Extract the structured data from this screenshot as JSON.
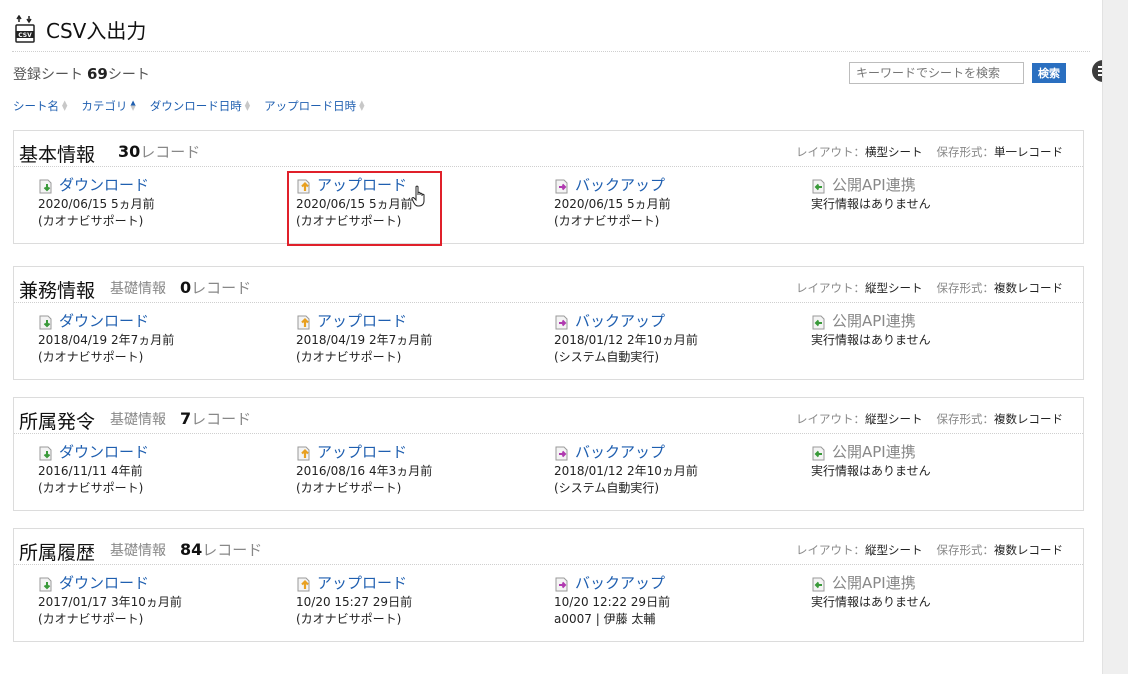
{
  "header": {
    "title": "CSV入出力",
    "icon": "csv-file-icon"
  },
  "summary": {
    "label": "登録シート",
    "count": "69",
    "unit": "シート"
  },
  "search": {
    "placeholder": "キーワードでシートを検索",
    "button": "検索"
  },
  "sort": [
    {
      "label": "シート名",
      "active": false
    },
    {
      "label": "カテゴリ",
      "active": true
    },
    {
      "label": "ダウンロード日時",
      "active": false
    },
    {
      "label": "アップロード日時",
      "active": false
    }
  ],
  "sheets": [
    {
      "name": "基本情報",
      "category": "",
      "count": "30",
      "unit": "レコード",
      "layout_label": "レイアウト：",
      "layout": "横型シート",
      "format_label": "保存形式：",
      "format": "単一レコード",
      "download": {
        "label": "ダウンロード",
        "line1": "2020/06/15 5ヵ月前",
        "line2": "(カオナビサポート)"
      },
      "upload": {
        "label": "アップロード",
        "line1": "2020/06/15 5ヵ月前",
        "line2": "(カオナビサポート)"
      },
      "backup": {
        "label": "バックアップ",
        "line1": "2020/06/15 5ヵ月前",
        "line2": "(カオナビサポート)"
      },
      "api": {
        "label": "公開API連携",
        "line1": "実行情報はありません"
      }
    },
    {
      "name": "兼務情報",
      "category": "基礎情報",
      "count": "0",
      "unit": "レコード",
      "layout_label": "レイアウト：",
      "layout": "縦型シート",
      "format_label": "保存形式：",
      "format": "複数レコード",
      "download": {
        "label": "ダウンロード",
        "line1": "2018/04/19 2年7ヵ月前",
        "line2": "(カオナビサポート)"
      },
      "upload": {
        "label": "アップロード",
        "line1": "2018/04/19 2年7ヵ月前",
        "line2": "(カオナビサポート)"
      },
      "backup": {
        "label": "バックアップ",
        "line1": "2018/01/12 2年10ヵ月前",
        "line2": "(システム自動実行)"
      },
      "api": {
        "label": "公開API連携",
        "line1": "実行情報はありません"
      }
    },
    {
      "name": "所属発令",
      "category": "基礎情報",
      "count": "7",
      "unit": "レコード",
      "layout_label": "レイアウト：",
      "layout": "縦型シート",
      "format_label": "保存形式：",
      "format": "複数レコード",
      "download": {
        "label": "ダウンロード",
        "line1": "2016/11/11 4年前",
        "line2": "(カオナビサポート)"
      },
      "upload": {
        "label": "アップロード",
        "line1": "2016/08/16 4年3ヵ月前",
        "line2": "(カオナビサポート)"
      },
      "backup": {
        "label": "バックアップ",
        "line1": "2018/01/12 2年10ヵ月前",
        "line2": "(システム自動実行)"
      },
      "api": {
        "label": "公開API連携",
        "line1": "実行情報はありません"
      }
    },
    {
      "name": "所属履歴",
      "category": "基礎情報",
      "count": "84",
      "unit": "レコード",
      "layout_label": "レイアウト：",
      "layout": "縦型シート",
      "format_label": "保存形式：",
      "format": "複数レコード",
      "download": {
        "label": "ダウンロード",
        "line1": "2017/01/17 3年10ヵ月前",
        "line2": "(カオナビサポート)"
      },
      "upload": {
        "label": "アップロード",
        "line1": "10/20 15:27 29日前",
        "line2": "(カオナビサポート)"
      },
      "backup": {
        "label": "バックアップ",
        "line1": "10/20 12:22 29日前",
        "line2": "a0007 | 伊藤 太輔"
      },
      "api": {
        "label": "公開API連携",
        "line1": "実行情報はありません"
      }
    }
  ],
  "colors": {
    "link": "#1f5fb0",
    "highlight": "#e0202a",
    "search_button": "#2a6fc0"
  }
}
